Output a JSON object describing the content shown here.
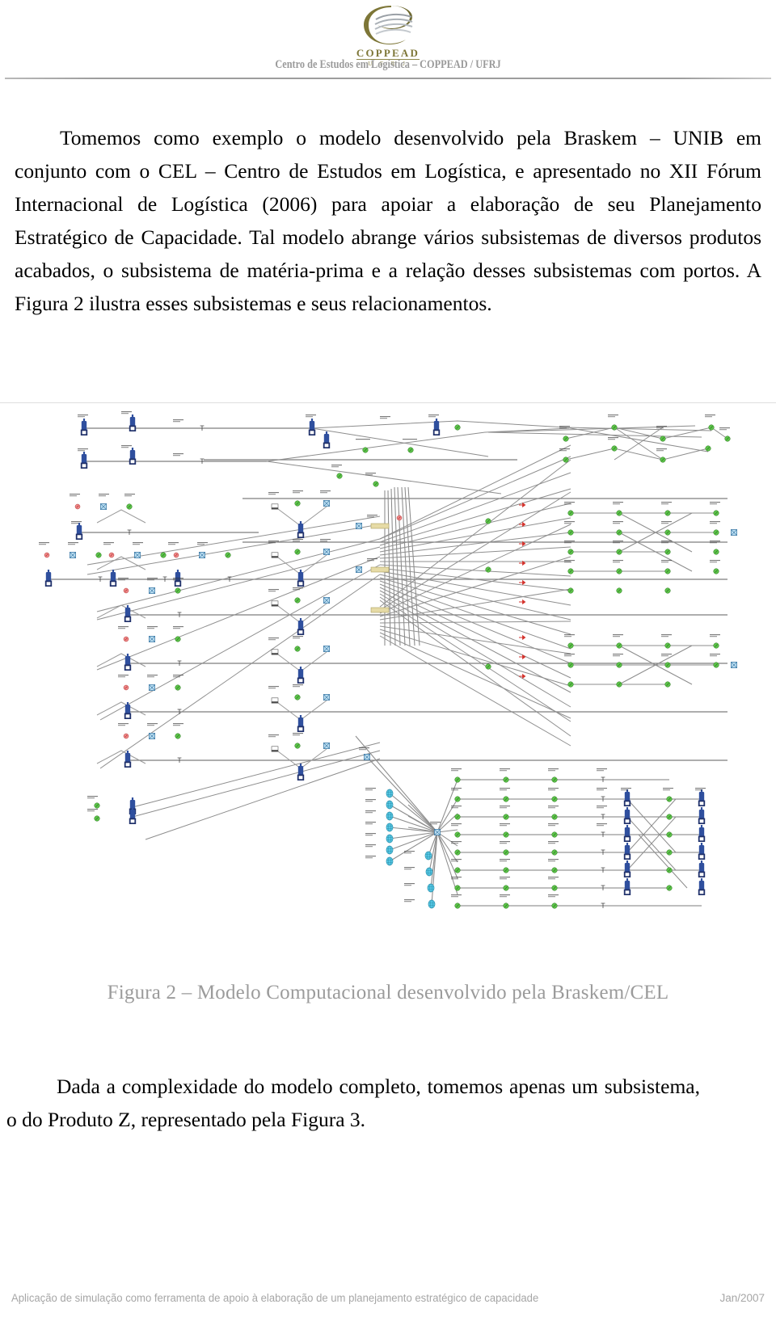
{
  "header": {
    "logo_word": "COPPEAD",
    "logo_sub": "U F R J",
    "title": "Centro de Estudos em Logística – COPPEAD / UFRJ"
  },
  "body": {
    "paragraph_1": "Tomemos como exemplo o modelo desenvolvido pela Braskem – UNIB em conjunto com o CEL – Centro de Estudos em Logística, e apresentado no XII Fórum Internacional de Logística (2006) para apoiar a elaboração de seu Planejamento Estratégico de Capacidade. Tal modelo abrange vários subsistemas de diversos produtos acabados, o subsistema de matéria-prima e a relação desses subsistemas com portos. A Figura 2 ilustra esses subsistemas e seus relacionamentos.",
    "paragraph_2": "Dada a complexidade do modelo completo, tomemos apenas um subsistema, o do Produto Z, representado pela Figura 3."
  },
  "figure": {
    "caption": "Figura 2 – Modelo Computacional desenvolvido pela Braskem/CEL",
    "alt": "Modelo computacional de simulação: rede densa de subsistemas de produtos acabados, subsistema de matéria-prima e portos, com tanques, processos e ligações"
  },
  "footer": {
    "left": "Aplicação de simulação como ferramenta de apoio à elaboração de um planejamento estratégico de capacidade",
    "right": "Jan/2007"
  },
  "colors": {
    "header_title": "#9a9a9a",
    "logo_gold": "#8d8648",
    "logo_gray": "#9aa0a6",
    "caption": "#9b9b9b",
    "footer": "#a6a6a6",
    "node_tank": "#2f4f9e",
    "node_green": "#4caf3f",
    "node_cyan": "#4fc3dd",
    "node_red": "#d4322c",
    "node_yellow": "#d6c98a",
    "edge": "#8a8a8a"
  }
}
